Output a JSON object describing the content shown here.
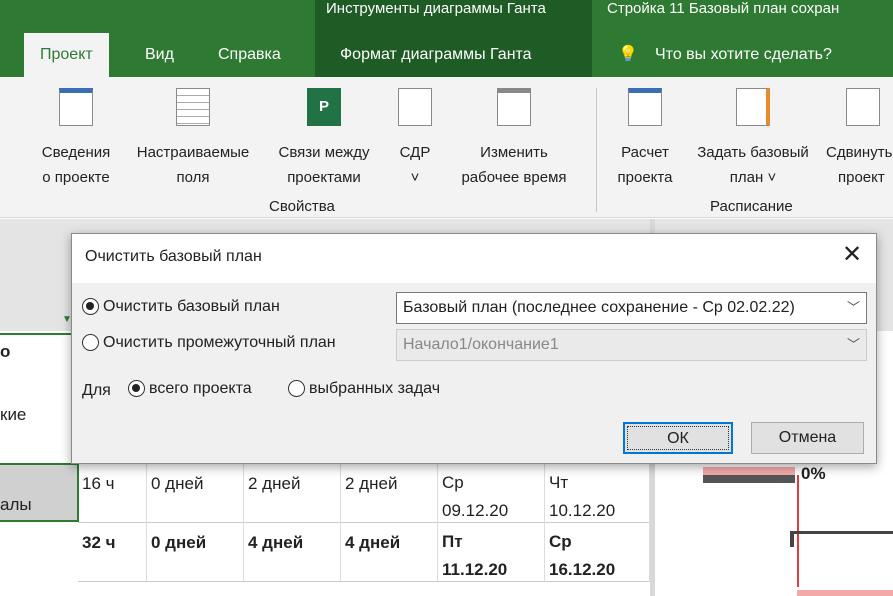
{
  "title_bar": {
    "context_group": "Инструменты диаграммы Ганта",
    "document_title": "Стройка 11 Базовый план сохран"
  },
  "tabs": [
    {
      "label": "Проект",
      "active": true
    },
    {
      "label": "Вид"
    },
    {
      "label": "Справка"
    },
    {
      "label": "Формат диаграммы Ганта"
    }
  ],
  "tell_me": "Что вы хотите сделать?",
  "ribbon": {
    "buttons": [
      {
        "l1": "Сведения",
        "l2": "о проекте",
        "icon": "project-info-icon"
      },
      {
        "l1": "Настраиваемые",
        "l2": "поля",
        "icon": "custom-fields-icon"
      },
      {
        "l1": "Связи между",
        "l2": "проектами",
        "icon": "links-between-projects-icon"
      },
      {
        "l1": "СДР",
        "l2": "˅",
        "icon": "wbs-icon"
      },
      {
        "l1": "Изменить",
        "l2": "рабочее время",
        "icon": "change-working-time-icon"
      },
      {
        "l1": "Расчет",
        "l2": "проекта",
        "icon": "calculate-project-icon"
      },
      {
        "l1": "Задать базовый",
        "l2": "план ˅",
        "icon": "set-baseline-icon"
      },
      {
        "l1": "Сдвинуть",
        "l2": "проект",
        "icon": "move-project-icon"
      }
    ],
    "groups": [
      "Свойства",
      "Расписание"
    ]
  },
  "left_column": [
    "о",
    "кие",
    "алы"
  ],
  "rows": [
    {
      "work": "16 ч",
      "c2": "0 дней",
      "c3": "2 дней",
      "c4": "2 дней",
      "start": "Ср\n09.12.20",
      "finish": "Чт\n10.12.20",
      "bold": false
    },
    {
      "work": "32 ч",
      "c2": "0 дней",
      "c3": "4 дней",
      "c4": "4 дней",
      "start": "Пт\n11.12.20",
      "finish": "Ср\n16.12.20",
      "bold": true
    }
  ],
  "gantt": {
    "progress_label": "0%",
    "colors": {
      "baseline": "#f4a9a9",
      "bar": "#555555",
      "link": "#e23b3b"
    }
  },
  "dialog": {
    "title": "Очистить базовый план",
    "option_baseline": "Очистить базовый план",
    "option_interim": "Очистить промежуточный план",
    "baseline_select": "Базовый план (последнее сохранение - Ср 02.02.22)",
    "interim_select": "Начало1/окончание1",
    "for_label": "Для",
    "scope_all": "всего проекта",
    "scope_selected": "выбранных задач",
    "ok": "ОК",
    "cancel": "Отмена"
  }
}
